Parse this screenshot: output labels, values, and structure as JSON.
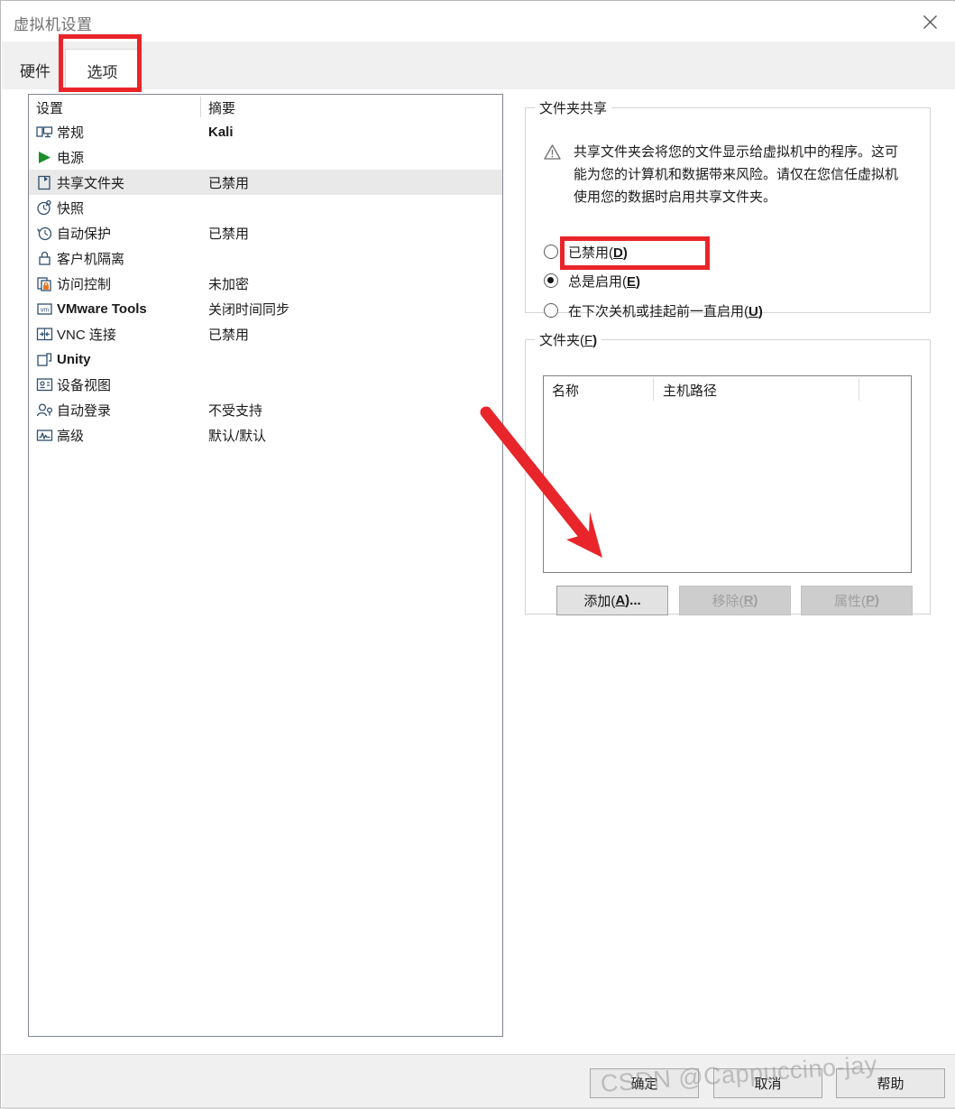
{
  "window": {
    "title": "虚拟机设置",
    "close_icon": "close-icon"
  },
  "tabs": [
    {
      "id": "hardware",
      "label": "硬件",
      "active": false
    },
    {
      "id": "options",
      "label": "选项",
      "active": true
    }
  ],
  "settings_list": {
    "headers": {
      "name": "设置",
      "summary": "摘要"
    },
    "rows": [
      {
        "icon": "monitor-icon",
        "label": "常规",
        "summary": "Kali",
        "selected": false,
        "bold_label": false,
        "bold_summary": true
      },
      {
        "icon": "power-play-icon",
        "label": "电源",
        "summary": "",
        "selected": false,
        "bold_label": false,
        "bold_summary": false
      },
      {
        "icon": "shared-folder-icon",
        "label": "共享文件夹",
        "summary": "已禁用",
        "selected": true,
        "bold_label": false,
        "bold_summary": false
      },
      {
        "icon": "snapshot-icon",
        "label": "快照",
        "summary": "",
        "selected": false,
        "bold_label": false,
        "bold_summary": false
      },
      {
        "icon": "autoprotect-icon",
        "label": "自动保护",
        "summary": "已禁用",
        "selected": false,
        "bold_label": false,
        "bold_summary": false
      },
      {
        "icon": "lock-icon",
        "label": "客户机隔离",
        "summary": "",
        "selected": false,
        "bold_label": false,
        "bold_summary": false
      },
      {
        "icon": "access-control-icon",
        "label": "访问控制",
        "summary": "未加密",
        "selected": false,
        "bold_label": false,
        "bold_summary": false
      },
      {
        "icon": "vmware-tools-icon",
        "label": "VMware Tools",
        "summary": "关闭时间同步",
        "selected": false,
        "bold_label": true,
        "bold_summary": false
      },
      {
        "icon": "vnc-icon",
        "label": "VNC 连接",
        "summary": "已禁用",
        "selected": false,
        "bold_label": false,
        "bold_summary": false
      },
      {
        "icon": "unity-icon",
        "label": "Unity",
        "summary": "",
        "selected": false,
        "bold_label": true,
        "bold_summary": false
      },
      {
        "icon": "device-view-icon",
        "label": "设备视图",
        "summary": "",
        "selected": false,
        "bold_label": false,
        "bold_summary": false
      },
      {
        "icon": "auto-login-icon",
        "label": "自动登录",
        "summary": "不受支持",
        "selected": false,
        "bold_label": false,
        "bold_summary": false
      },
      {
        "icon": "advanced-icon",
        "label": "高级",
        "summary": "默认/默认",
        "selected": false,
        "bold_label": false,
        "bold_summary": false
      }
    ]
  },
  "sharing_group": {
    "legend": "文件夹共享",
    "warning_icon": "warning-triangle-icon",
    "warning_text": "共享文件夹会将您的文件显示给虚拟机中的程序。这可能为您的计算机和数据带来风险。请仅在您信任虚拟机使用您的数据时启用共享文件夹。",
    "options": [
      {
        "id": "disabled",
        "label": "已禁用(",
        "accel": "D",
        "tail": ")",
        "checked": false
      },
      {
        "id": "always",
        "label": "总是启用(",
        "accel": "E",
        "tail": ")",
        "checked": true
      },
      {
        "id": "until",
        "label": "在下次关机或挂起前一直启用(",
        "accel": "U",
        "tail": ")",
        "checked": false
      }
    ]
  },
  "folders_group": {
    "legend_text": "文件夹(",
    "legend_accel": "F",
    "legend_tail": ")",
    "columns": [
      "名称",
      "主机路径",
      ""
    ],
    "rows": [],
    "buttons": [
      {
        "id": "add",
        "text": "添加(",
        "accel": "A",
        "tail": ")...",
        "disabled": false
      },
      {
        "id": "remove",
        "text": "移除(",
        "accel": "R",
        "tail": ")",
        "disabled": true
      },
      {
        "id": "props",
        "text": "属性(",
        "accel": "P",
        "tail": ")",
        "disabled": true
      }
    ]
  },
  "footer": {
    "ok": "确定",
    "cancel": "取消",
    "help": "帮助"
  },
  "watermark": "CSDN @Cappuccino-jay",
  "annotations": {
    "accent_color": "#e8252a",
    "tab_highlight": "选项",
    "radio_highlight": "总是启用(E)",
    "arrow_target": "添加(A)..."
  }
}
